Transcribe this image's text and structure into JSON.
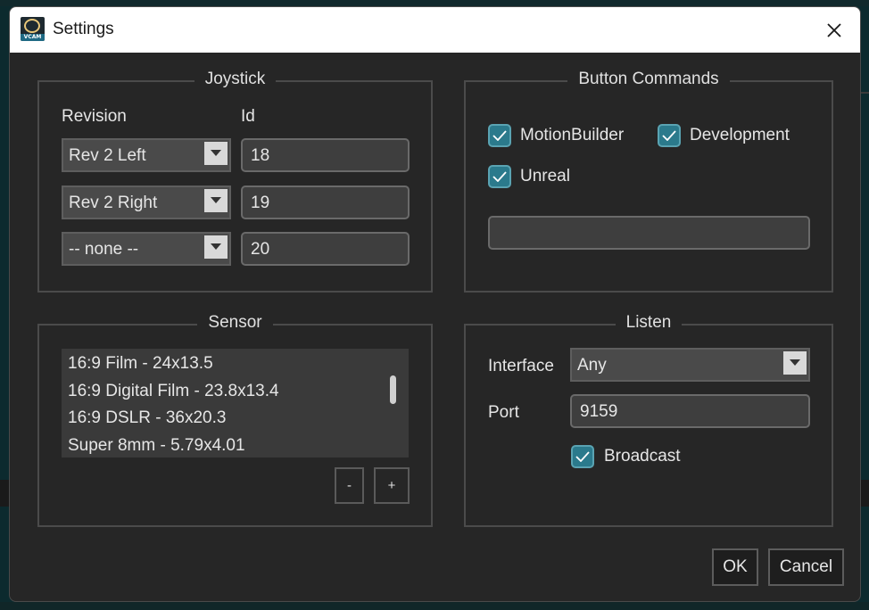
{
  "window": {
    "title": "Settings",
    "icon": "vcam-app-icon",
    "icon_text": "VCAM"
  },
  "joystick": {
    "title": "Joystick",
    "revision_header": "Revision",
    "id_header": "Id",
    "rows": [
      {
        "revision": "Rev 2 Left",
        "id": "18"
      },
      {
        "revision": "Rev 2 Right",
        "id": "19"
      },
      {
        "revision": "-- none --",
        "id": "20"
      }
    ]
  },
  "button_commands": {
    "title": "Button Commands",
    "checkboxes": [
      {
        "label": "MotionBuilder",
        "checked": true
      },
      {
        "label": "Development",
        "checked": true
      },
      {
        "label": "Unreal",
        "checked": true
      }
    ],
    "text_value": ""
  },
  "sensor": {
    "title": "Sensor",
    "items": [
      "16:9 Film - 24x13.5",
      "16:9 Digital Film - 23.8x13.4",
      "16:9 DSLR - 36x20.3",
      "Super 8mm - 5.79x4.01"
    ],
    "remove_label": "-",
    "add_label": "+"
  },
  "listen": {
    "title": "Listen",
    "interface_label": "Interface",
    "interface_value": "Any",
    "port_label": "Port",
    "port_value": "9159",
    "broadcast_label": "Broadcast",
    "broadcast_checked": true
  },
  "footer": {
    "ok_label": "OK",
    "cancel_label": "Cancel"
  },
  "colors": {
    "accent": "#2b7a8c",
    "dialog_bg": "#262626",
    "titlebar_bg": "#ffffff"
  }
}
